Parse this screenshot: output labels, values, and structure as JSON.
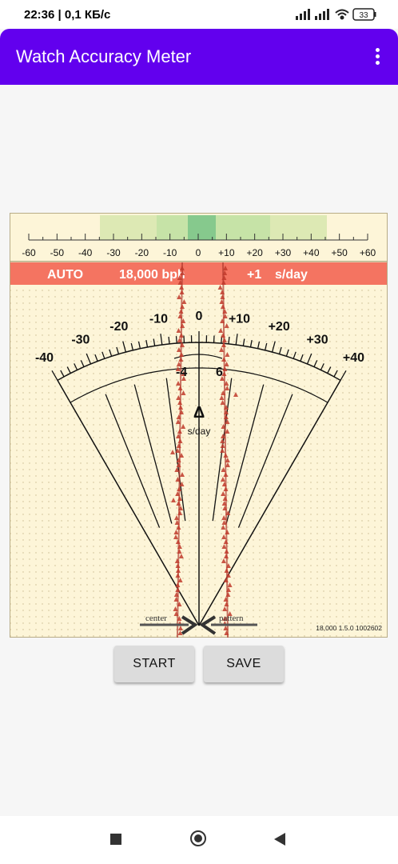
{
  "status": {
    "time_net": "22:36 | 0,1 КБ/с",
    "battery": "33"
  },
  "app": {
    "title": "Watch Accuracy Meter"
  },
  "meter": {
    "strip_scale": [
      "-60",
      "-50",
      "-40",
      "-30",
      "-20",
      "-10",
      "0",
      "+10",
      "+20",
      "+30",
      "+40",
      "+50",
      "+60"
    ],
    "mode": "AUTO",
    "rate": "18,000 bph",
    "deviation": "+1",
    "deviation_unit": "s/day",
    "dial_scale": [
      "-40",
      "-30",
      "-20",
      "-10",
      "0",
      "+10",
      "+20",
      "+30",
      "+40"
    ],
    "marker_left": "-4",
    "marker_right": "6",
    "delta_symbol": "Δ",
    "delta_unit": "s/day",
    "label_center": "center",
    "label_pattern": "pattern",
    "version": "18,000 1.5.0 1002602",
    "colors": {
      "paper": "#fdf5d8",
      "banner": "#f47461",
      "trace": "#c0392b",
      "band_outer": "#dde9b4",
      "band_mid": "#c6e3a7",
      "band_inner": "#86c98d"
    }
  },
  "buttons": {
    "start": "START",
    "save": "SAVE"
  }
}
